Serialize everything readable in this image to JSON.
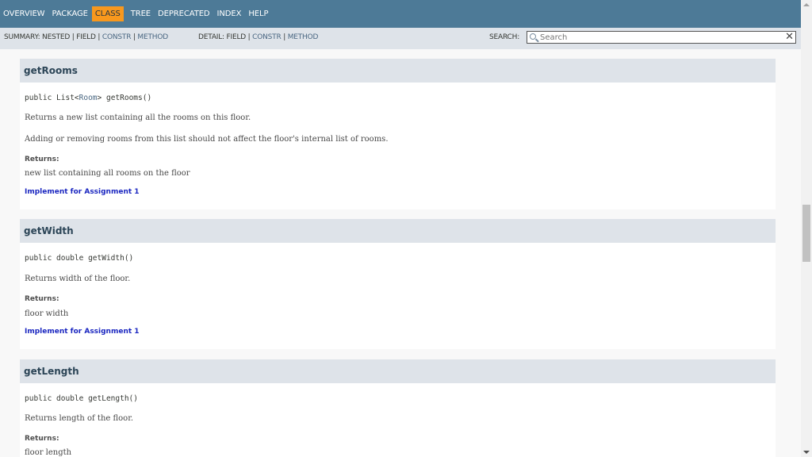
{
  "nav": {
    "items": [
      {
        "label": "OVERVIEW"
      },
      {
        "label": "PACKAGE"
      },
      {
        "label": "CLASS",
        "active": true
      },
      {
        "label": "TREE"
      },
      {
        "label": "DEPRECATED"
      },
      {
        "label": "INDEX"
      },
      {
        "label": "HELP"
      }
    ]
  },
  "subnav": {
    "summary_prefix": "SUMMARY: NESTED | FIELD | ",
    "summary_constr": "CONSTR",
    "summary_sep": " | ",
    "summary_method": "METHOD",
    "detail_prefix": "DETAIL: FIELD | ",
    "detail_constr": "CONSTR",
    "detail_sep": " | ",
    "detail_method": "METHOD",
    "search_label": "SEARCH:",
    "search_placeholder": "Search",
    "clear_glyph": "✕"
  },
  "methods": [
    {
      "name": "getRooms",
      "sig_prefix": "public List<",
      "sig_type": "Room",
      "sig_suffix": "> getRooms()",
      "desc1": "Returns a new list containing all the rooms on this floor.",
      "desc2": "Adding or removing rooms from this list should not affect the floor's internal list of rooms.",
      "returns_label": "Returns:",
      "returns_value": "new list containing all rooms on the floor",
      "link": "Implement for Assignment 1"
    },
    {
      "name": "getWidth",
      "sig": "public double getWidth()",
      "desc1": "Returns width of the floor.",
      "returns_label": "Returns:",
      "returns_value": "floor width",
      "link": "Implement for Assignment 1"
    },
    {
      "name": "getLength",
      "sig": "public double getLength()",
      "desc1": "Returns length of the floor.",
      "returns_label": "Returns:",
      "returns_value": "floor length"
    }
  ],
  "colors": {
    "nav_bg": "#4d7a97",
    "nav_active_bg": "#f8981d",
    "subnav_bg": "#dee3e9",
    "link": "#4a6782",
    "impl_link": "#1a26c0"
  }
}
